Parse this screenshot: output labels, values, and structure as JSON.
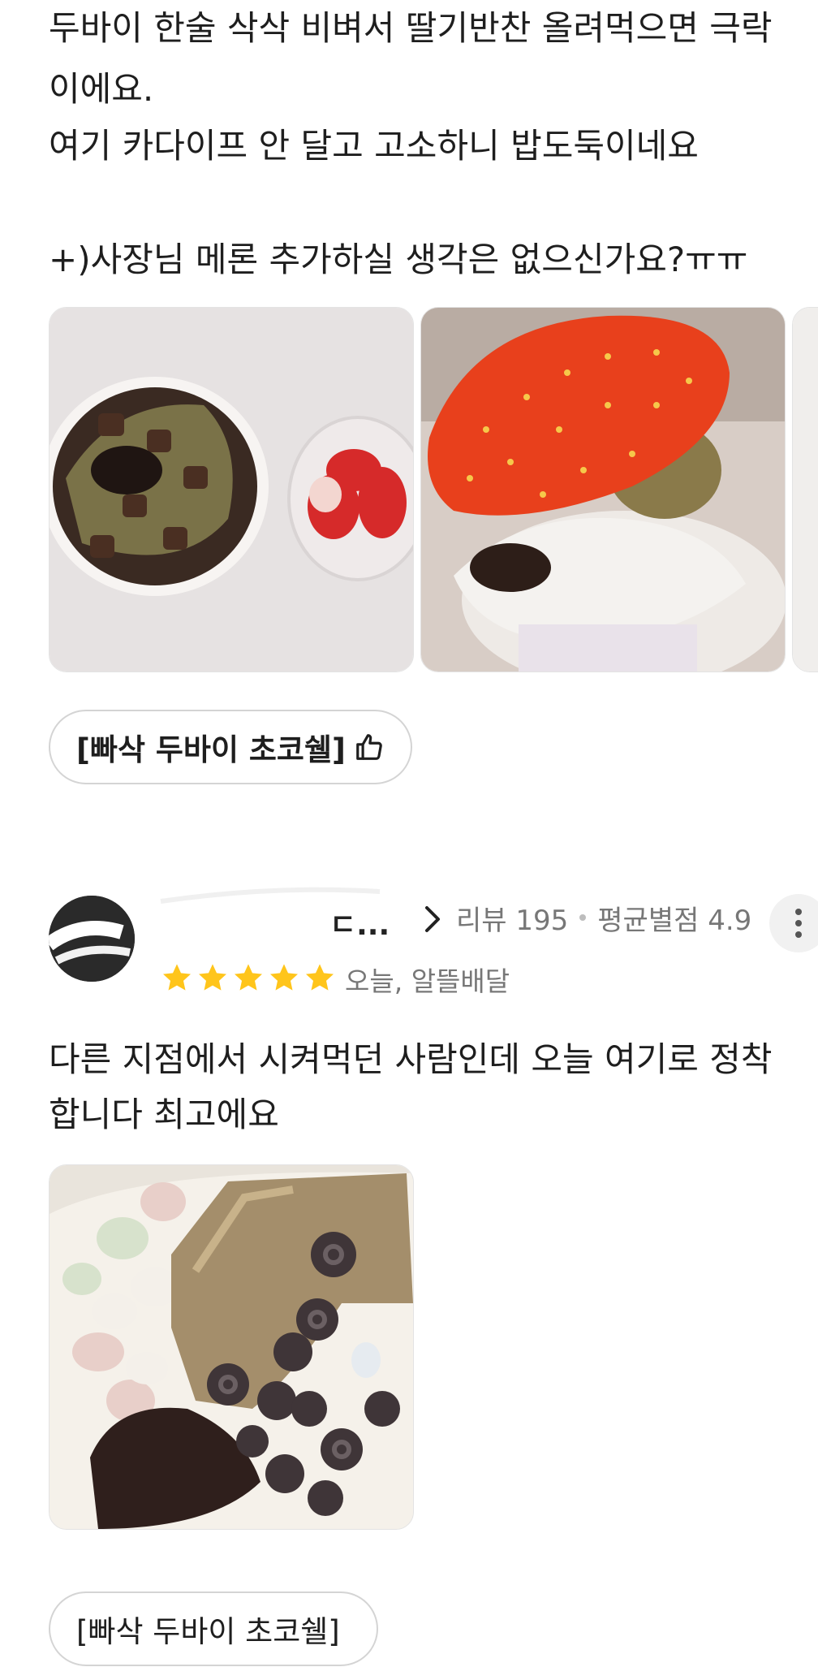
{
  "review1": {
    "text_lines": [
      "두바이 한술 삭삭 비벼서 딸기반찬 올려먹으면 극락",
      "이에요.",
      "여기 카다이프 안 달고 고소하니 밥도둑이네요",
      "",
      "+)사장님 메론 추가하실 생각은 없으신가요?ㅠㅠ"
    ],
    "menu_tag": "[빠삭 두바이 초코쉘]",
    "menu_tag_icon": "thumbs-up-icon"
  },
  "review2": {
    "author_name_visible": "ㄷ...",
    "review_count_label": "리뷰 195",
    "avg_rating_label": "평균별점 4.9",
    "rating": 5,
    "delivery_info": "오늘, 알뜰배달",
    "text_lines": [
      "다른 지점에서 시켜먹던 사람인데 오늘 여기로 정착",
      "합니다 최고에요"
    ],
    "menu_tag": "[빠삭 두바이 초코쉘]"
  },
  "colors": {
    "star": "#FFC51B",
    "text": "#1E1E1E",
    "meta": "#777777",
    "strawberry": "#E8401C"
  }
}
